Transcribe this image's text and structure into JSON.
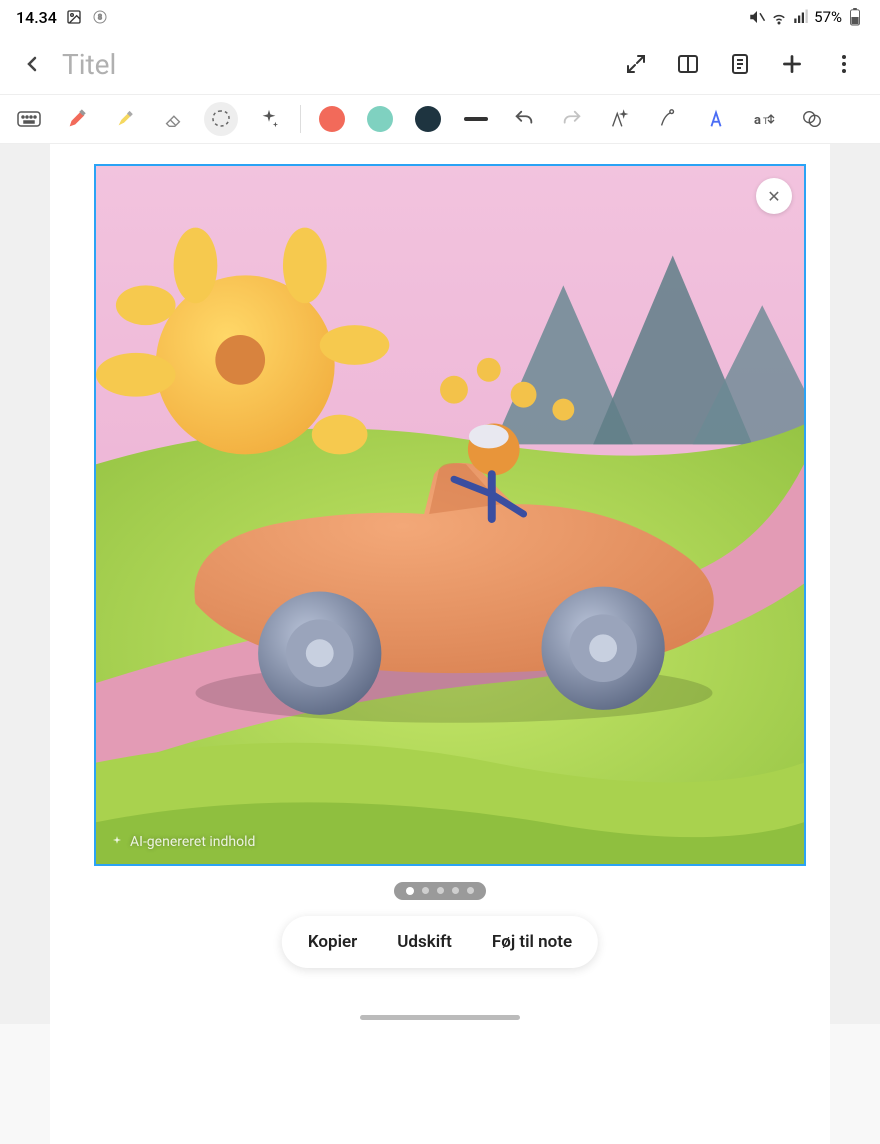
{
  "status": {
    "time": "14.34",
    "battery": "57%"
  },
  "header": {
    "title_placeholder": "Titel"
  },
  "toolbar": {
    "swatch1": "#f26a5a",
    "swatch2": "#7fd1c0",
    "swatch3": "#1e3440"
  },
  "image": {
    "ai_label": "AI-genereret indhold",
    "close_glyph": "✕"
  },
  "pager": {
    "count": 5,
    "active": 1
  },
  "actions": {
    "copy": "Kopier",
    "replace": "Udskift",
    "add": "Føj til note"
  }
}
